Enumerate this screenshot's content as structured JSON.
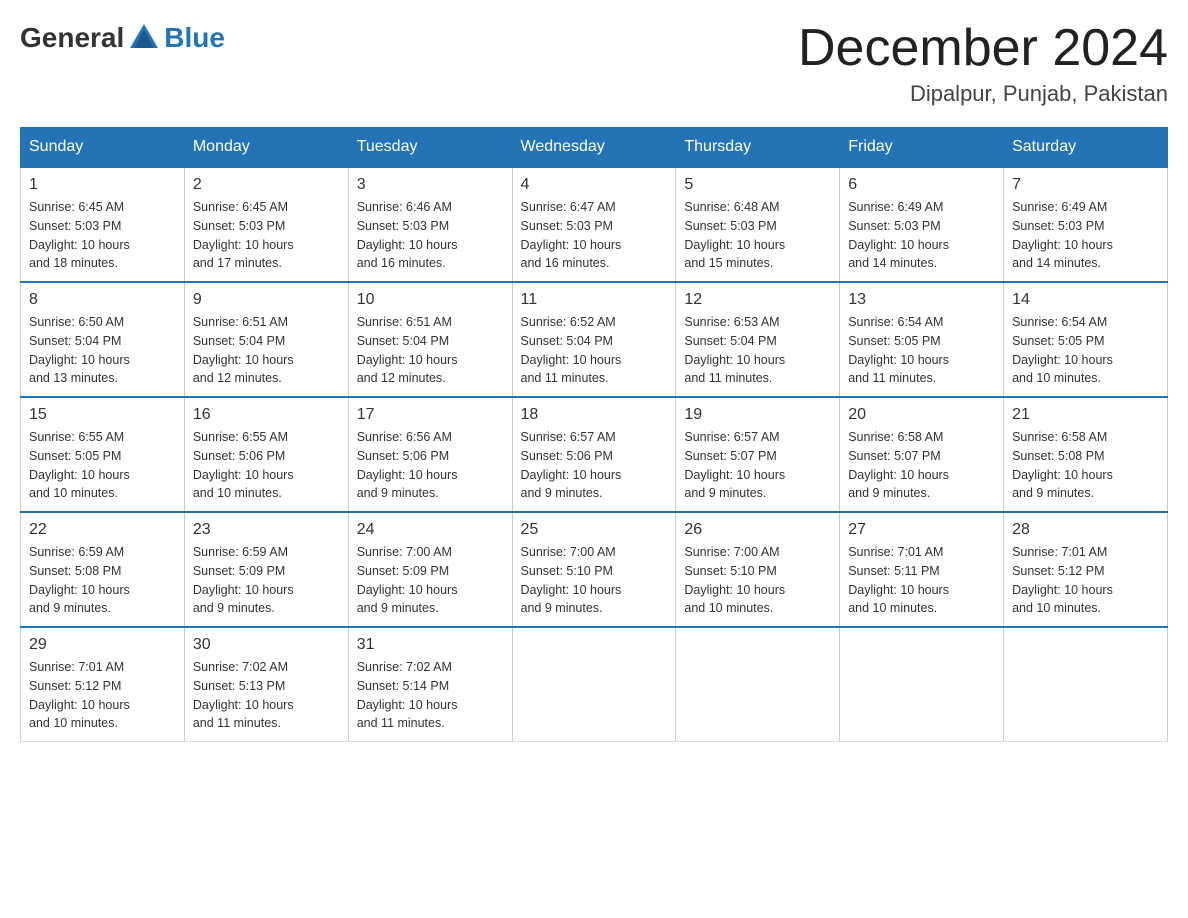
{
  "header": {
    "logo_general": "General",
    "logo_blue": "Blue",
    "title": "December 2024",
    "subtitle": "Dipalpur, Punjab, Pakistan"
  },
  "days_of_week": [
    "Sunday",
    "Monday",
    "Tuesday",
    "Wednesday",
    "Thursday",
    "Friday",
    "Saturday"
  ],
  "weeks": [
    [
      {
        "day": "1",
        "sunrise": "6:45 AM",
        "sunset": "5:03 PM",
        "daylight": "10 hours and 18 minutes."
      },
      {
        "day": "2",
        "sunrise": "6:45 AM",
        "sunset": "5:03 PM",
        "daylight": "10 hours and 17 minutes."
      },
      {
        "day": "3",
        "sunrise": "6:46 AM",
        "sunset": "5:03 PM",
        "daylight": "10 hours and 16 minutes."
      },
      {
        "day": "4",
        "sunrise": "6:47 AM",
        "sunset": "5:03 PM",
        "daylight": "10 hours and 16 minutes."
      },
      {
        "day": "5",
        "sunrise": "6:48 AM",
        "sunset": "5:03 PM",
        "daylight": "10 hours and 15 minutes."
      },
      {
        "day": "6",
        "sunrise": "6:49 AM",
        "sunset": "5:03 PM",
        "daylight": "10 hours and 14 minutes."
      },
      {
        "day": "7",
        "sunrise": "6:49 AM",
        "sunset": "5:03 PM",
        "daylight": "10 hours and 14 minutes."
      }
    ],
    [
      {
        "day": "8",
        "sunrise": "6:50 AM",
        "sunset": "5:04 PM",
        "daylight": "10 hours and 13 minutes."
      },
      {
        "day": "9",
        "sunrise": "6:51 AM",
        "sunset": "5:04 PM",
        "daylight": "10 hours and 12 minutes."
      },
      {
        "day": "10",
        "sunrise": "6:51 AM",
        "sunset": "5:04 PM",
        "daylight": "10 hours and 12 minutes."
      },
      {
        "day": "11",
        "sunrise": "6:52 AM",
        "sunset": "5:04 PM",
        "daylight": "10 hours and 11 minutes."
      },
      {
        "day": "12",
        "sunrise": "6:53 AM",
        "sunset": "5:04 PM",
        "daylight": "10 hours and 11 minutes."
      },
      {
        "day": "13",
        "sunrise": "6:54 AM",
        "sunset": "5:05 PM",
        "daylight": "10 hours and 11 minutes."
      },
      {
        "day": "14",
        "sunrise": "6:54 AM",
        "sunset": "5:05 PM",
        "daylight": "10 hours and 10 minutes."
      }
    ],
    [
      {
        "day": "15",
        "sunrise": "6:55 AM",
        "sunset": "5:05 PM",
        "daylight": "10 hours and 10 minutes."
      },
      {
        "day": "16",
        "sunrise": "6:55 AM",
        "sunset": "5:06 PM",
        "daylight": "10 hours and 10 minutes."
      },
      {
        "day": "17",
        "sunrise": "6:56 AM",
        "sunset": "5:06 PM",
        "daylight": "10 hours and 9 minutes."
      },
      {
        "day": "18",
        "sunrise": "6:57 AM",
        "sunset": "5:06 PM",
        "daylight": "10 hours and 9 minutes."
      },
      {
        "day": "19",
        "sunrise": "6:57 AM",
        "sunset": "5:07 PM",
        "daylight": "10 hours and 9 minutes."
      },
      {
        "day": "20",
        "sunrise": "6:58 AM",
        "sunset": "5:07 PM",
        "daylight": "10 hours and 9 minutes."
      },
      {
        "day": "21",
        "sunrise": "6:58 AM",
        "sunset": "5:08 PM",
        "daylight": "10 hours and 9 minutes."
      }
    ],
    [
      {
        "day": "22",
        "sunrise": "6:59 AM",
        "sunset": "5:08 PM",
        "daylight": "10 hours and 9 minutes."
      },
      {
        "day": "23",
        "sunrise": "6:59 AM",
        "sunset": "5:09 PM",
        "daylight": "10 hours and 9 minutes."
      },
      {
        "day": "24",
        "sunrise": "7:00 AM",
        "sunset": "5:09 PM",
        "daylight": "10 hours and 9 minutes."
      },
      {
        "day": "25",
        "sunrise": "7:00 AM",
        "sunset": "5:10 PM",
        "daylight": "10 hours and 9 minutes."
      },
      {
        "day": "26",
        "sunrise": "7:00 AM",
        "sunset": "5:10 PM",
        "daylight": "10 hours and 10 minutes."
      },
      {
        "day": "27",
        "sunrise": "7:01 AM",
        "sunset": "5:11 PM",
        "daylight": "10 hours and 10 minutes."
      },
      {
        "day": "28",
        "sunrise": "7:01 AM",
        "sunset": "5:12 PM",
        "daylight": "10 hours and 10 minutes."
      }
    ],
    [
      {
        "day": "29",
        "sunrise": "7:01 AM",
        "sunset": "5:12 PM",
        "daylight": "10 hours and 10 minutes."
      },
      {
        "day": "30",
        "sunrise": "7:02 AM",
        "sunset": "5:13 PM",
        "daylight": "10 hours and 11 minutes."
      },
      {
        "day": "31",
        "sunrise": "7:02 AM",
        "sunset": "5:14 PM",
        "daylight": "10 hours and 11 minutes."
      },
      null,
      null,
      null,
      null
    ]
  ],
  "labels": {
    "sunrise": "Sunrise:",
    "sunset": "Sunset:",
    "daylight": "Daylight:"
  }
}
